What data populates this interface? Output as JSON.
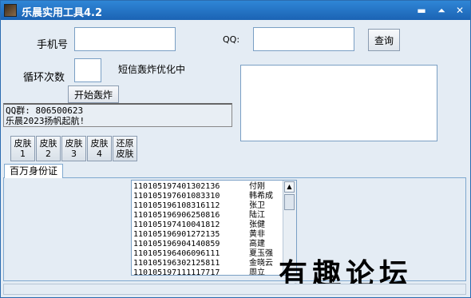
{
  "window": {
    "title": "乐晨实用工具4.2",
    "controls": {
      "minimize": "▬",
      "maximize": "⏶",
      "close": "✕"
    }
  },
  "form": {
    "phone_label": "手机号",
    "phone_value": "",
    "qq_label": "QQ:",
    "qq_value": "",
    "query_button": "查询",
    "loop_label": "循环次数",
    "loop_value": "",
    "sms_status": "短信轰炸优化中",
    "start_button": "开始轰炸",
    "result_text": ""
  },
  "notice": {
    "line1": "QQ群: 806500623",
    "line2": "乐晨2023扬帆起航!"
  },
  "skins": [
    {
      "line1": "皮肤",
      "line2": "1"
    },
    {
      "line1": "皮肤",
      "line2": "2"
    },
    {
      "line1": "皮肤",
      "line2": "3"
    },
    {
      "line1": "皮肤",
      "line2": "4"
    },
    {
      "line1": "还原",
      "line2": "皮肤"
    }
  ],
  "tab": {
    "label": "百万身份证"
  },
  "id_list": [
    {
      "id": "110105197401302136",
      "name": "付刚"
    },
    {
      "id": "110105197601083310",
      "name": "韩希成"
    },
    {
      "id": "110105196108316112",
      "name": "张卫"
    },
    {
      "id": "110105196906250816",
      "name": "陆江"
    },
    {
      "id": "110105197410041812",
      "name": "张健"
    },
    {
      "id": "110105196901272135",
      "name": "黄非"
    },
    {
      "id": "110105196904140859",
      "name": "高建"
    },
    {
      "id": "110105196406096111",
      "name": "夏玉强"
    },
    {
      "id": "110105196302125811",
      "name": "金晓云"
    },
    {
      "id": "110105197111117717",
      "name": "周立"
    }
  ],
  "watermark": "有趣论坛"
}
